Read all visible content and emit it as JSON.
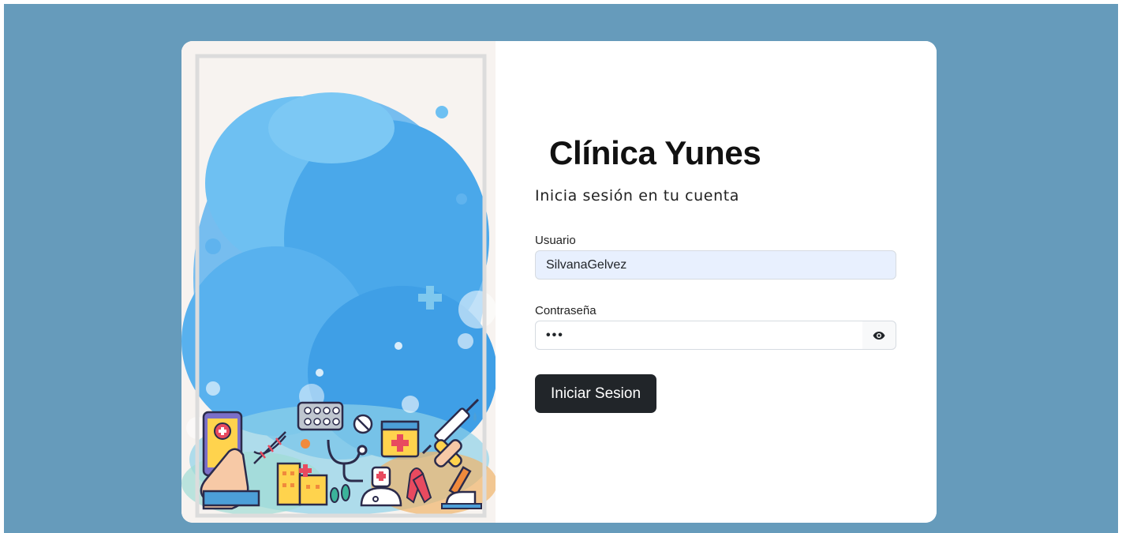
{
  "login": {
    "brand": "Clínica Yunes",
    "subtitle": "Inicia sesión en tu cuenta",
    "username_label": "Usuario",
    "username_value": "SilvanaGelvez",
    "password_label": "Contraseña",
    "password_value": "•••",
    "toggle_icon": "eye-icon",
    "submit_label": "Iniciar Sesion"
  },
  "colors": {
    "page_background": "#669bbb",
    "card_background": "#ffffff",
    "autofill_background": "#e8f0fe",
    "button_background": "#212529",
    "splash_blue": "#5fb3ee"
  },
  "illustration": {
    "icons": [
      "smartphone-icon",
      "dna-icon",
      "pill-pack-icon",
      "pill-icon",
      "stethoscope-icon",
      "medical-browser-icon",
      "syringe-icon",
      "hospital-icon",
      "doctor-icon",
      "ribbon-icon",
      "bandage-icon",
      "microscope-icon",
      "tree-icon"
    ]
  }
}
